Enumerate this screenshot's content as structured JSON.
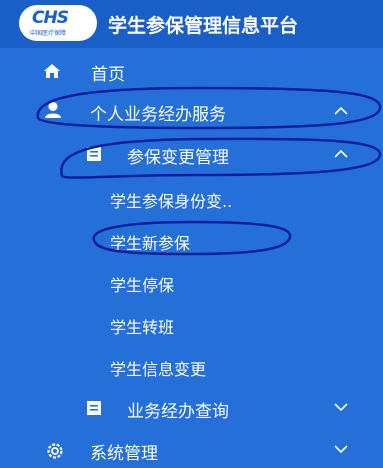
{
  "header": {
    "logo_text": "CHS",
    "logo_subtext": "中国医疗保障",
    "title": "学生参保管理信息平台"
  },
  "menu": {
    "home": {
      "label": "首页",
      "icon": "home-icon"
    },
    "personal_business": {
      "label": "个人业务经办服务",
      "icon": "user-icon",
      "expanded": true
    },
    "enrollment_change": {
      "label": "参保变更管理",
      "icon": "document-icon",
      "expanded": true
    },
    "sub_items": [
      {
        "label": "学生参保身份变.."
      },
      {
        "label": "学生新参保"
      },
      {
        "label": "学生停保"
      },
      {
        "label": "学生转班"
      },
      {
        "label": "学生信息变更"
      }
    ],
    "business_query": {
      "label": "业务经办查询",
      "icon": "document-icon",
      "expanded": false
    },
    "system_management": {
      "label": "系统管理",
      "icon": "gear-icon",
      "expanded": false
    }
  },
  "colors": {
    "sidebar_bg": "#2470d8",
    "header_bg": "#1a5fc7",
    "text": "#ffffff",
    "annotation_ink": "#0b1f9e"
  }
}
